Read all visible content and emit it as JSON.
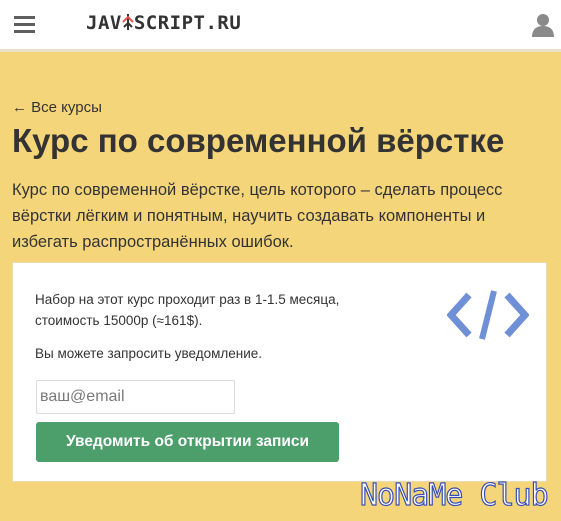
{
  "header": {
    "logo_prefix": "JAV",
    "logo_suffix": "SCRIPT.RU",
    "menu_icon": "hamburger-icon",
    "user_icon": "user-icon"
  },
  "nav": {
    "back_link": "← Все курсы"
  },
  "course": {
    "title": "Курс по современной вёрстке",
    "description": "Курс по современной вёрстке, цель которого – сделать процесс вёрстки лёгким и понятным, научить создавать компоненты и избегать распространённых ошибок."
  },
  "signup": {
    "info": "Набор на этот курс проходит раз в 1-1.5 месяца, стоимость 15000р (≈161$).",
    "notice": "Вы можете запросить уведомление.",
    "email_placeholder": "ваш@email",
    "button_label": "Уведомить об открытии записи",
    "icon": "code-icon"
  },
  "watermark": "NoNaMe Club",
  "colors": {
    "background": "#f5d57a",
    "button": "#4c9e6a",
    "code_icon": "#6f8fd6",
    "logo_accent": "#e2534b"
  }
}
